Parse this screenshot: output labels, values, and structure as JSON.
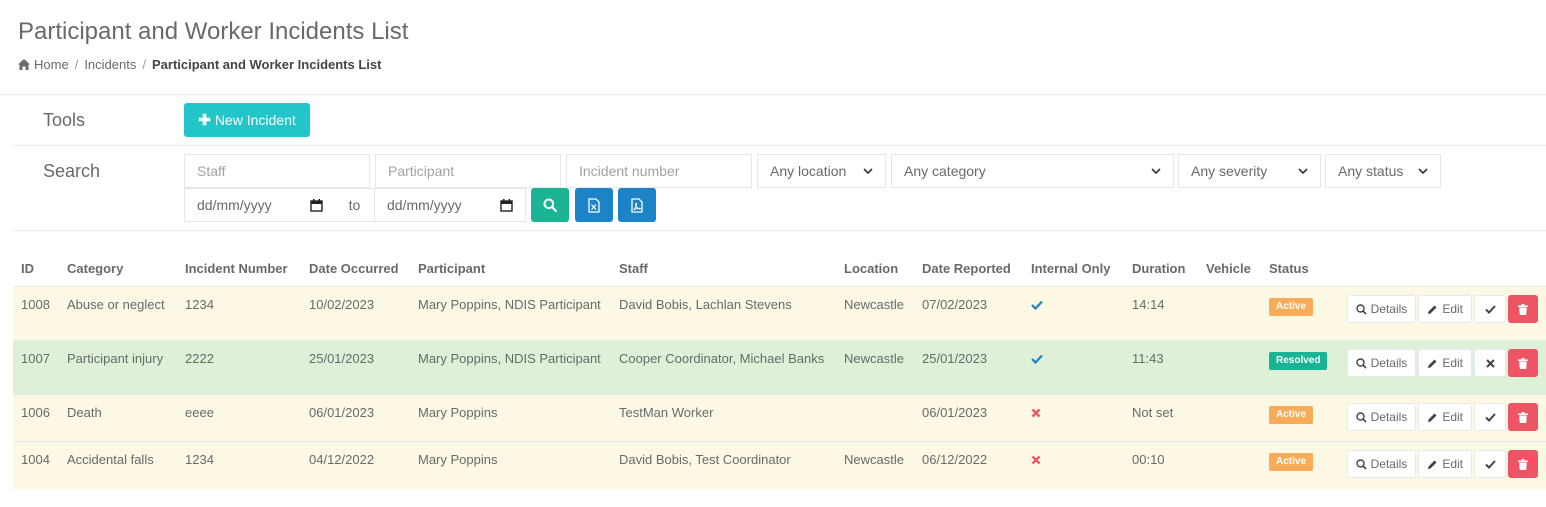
{
  "page": {
    "title": "Participant and Worker Incidents List"
  },
  "breadcrumb": {
    "home": "Home",
    "section": "Incidents",
    "current": "Participant and Worker Incidents List"
  },
  "tools": {
    "label": "Tools",
    "new_incident": "New Incident"
  },
  "search": {
    "label": "Search",
    "staff_placeholder": "Staff",
    "participant_placeholder": "Participant",
    "incident_number_placeholder": "Incident number",
    "location": "Any location",
    "category": "Any category",
    "severity": "Any severity",
    "status": "Any status",
    "date_from": "dd/mm/yyyy",
    "to_label": "to",
    "date_to": "dd/mm/yyyy",
    "icons": [
      "search-icon",
      "excel-file-icon",
      "pdf-file-icon"
    ]
  },
  "table": {
    "headers": {
      "id": "ID",
      "category": "Category",
      "incident_number": "Incident Number",
      "date_occurred": "Date Occurred",
      "participant": "Participant",
      "staff": "Staff",
      "location": "Location",
      "date_reported": "Date Reported",
      "internal_only": "Internal Only",
      "duration": "Duration",
      "vehicle": "Vehicle",
      "status": "Status"
    },
    "action_labels": {
      "details": "Details",
      "edit": "Edit"
    },
    "rows": [
      {
        "id": "1008",
        "category": "Abuse or neglect",
        "incident_number": "1234",
        "date_occurred": "10/02/2023",
        "participant": "Mary Poppins, NDIS Participant",
        "staff": "David Bobis, Lachlan Stevens",
        "location": "Newcastle",
        "date_reported": "07/02/2023",
        "internal_only": "check-icon",
        "duration": "14:14",
        "vehicle": "",
        "status": "Active"
      },
      {
        "id": "1007",
        "category": "Participant injury",
        "incident_number": "2222",
        "date_occurred": "25/01/2023",
        "participant": "Mary Poppins, NDIS Participant",
        "staff": "Cooper Coordinator, Michael Banks",
        "location": "Newcastle",
        "date_reported": "25/01/2023",
        "internal_only": "check-icon",
        "duration": "11:43",
        "vehicle": "",
        "status": "Resolved"
      },
      {
        "id": "1006",
        "category": "Death",
        "incident_number": "eeee",
        "date_occurred": "06/01/2023",
        "participant": "Mary Poppins",
        "staff": "TestMan Worker",
        "location": "",
        "date_reported": "06/01/2023",
        "internal_only": "cross-icon",
        "duration": "Not set",
        "vehicle": "",
        "status": "Active"
      },
      {
        "id": "1004",
        "category": "Accidental falls",
        "incident_number": "1234",
        "date_occurred": "04/12/2022",
        "participant": "Mary Poppins",
        "staff": "David Bobis, Test Coordinator",
        "location": "Newcastle",
        "date_reported": "06/12/2022",
        "internal_only": "cross-icon",
        "duration": "00:10",
        "vehicle": "",
        "status": "Active"
      }
    ]
  },
  "colors": {
    "teal": "#23c6c8",
    "green": "#1ab394",
    "blue": "#1c84c6",
    "active_badge": "#f8ac59",
    "danger": "#ed5565",
    "row_active": "#fcf8e3",
    "row_resolved": "#dff0d8"
  }
}
